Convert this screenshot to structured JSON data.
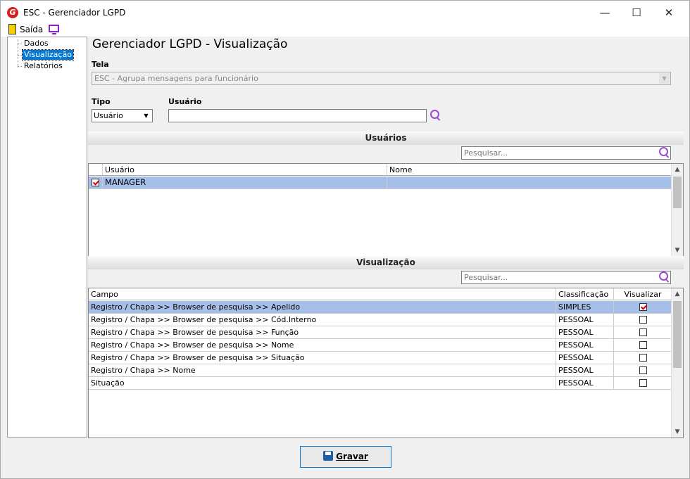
{
  "window": {
    "title": "ESC - Gerenciador LGPD",
    "logo_letter": "G"
  },
  "menubar": {
    "exit_label": "Saída"
  },
  "tree": {
    "items": [
      "Dados",
      "Visualização",
      "Relatórios"
    ],
    "selected": "Visualização"
  },
  "page_title": "Gerenciador LGPD - Visualização",
  "tela": {
    "label": "Tela",
    "value": "ESC - Agrupa mensagens para funcionário"
  },
  "tipo": {
    "label": "Tipo",
    "value": "Usuário"
  },
  "usuario": {
    "label": "Usuário",
    "value": ""
  },
  "usuarios_section": {
    "title": "Usuários",
    "filter_placeholder": "Pesquisar...",
    "columns": [
      "Usuário",
      "Nome"
    ],
    "rows": [
      {
        "checked": true,
        "usuario": "MANAGER",
        "nome": ""
      }
    ]
  },
  "visualizacao_section": {
    "title": "Visualização",
    "filter_placeholder": "Pesquisar...",
    "columns": [
      "Campo",
      "Classificação",
      "Visualizar"
    ],
    "rows": [
      {
        "campo": "Registro / Chapa >> Browser de pesquisa >> Apelido",
        "classificacao": "SIMPLES",
        "visualizar": true
      },
      {
        "campo": "Registro / Chapa >> Browser de pesquisa >> Cód.Interno",
        "classificacao": "PESSOAL",
        "visualizar": false
      },
      {
        "campo": "Registro / Chapa >> Browser de pesquisa >> Função",
        "classificacao": "PESSOAL",
        "visualizar": false
      },
      {
        "campo": "Registro / Chapa >> Browser de pesquisa >> Nome",
        "classificacao": "PESSOAL",
        "visualizar": false
      },
      {
        "campo": "Registro / Chapa >> Browser de pesquisa >> Situação",
        "classificacao": "PESSOAL",
        "visualizar": false
      },
      {
        "campo": "Registro / Chapa >> Nome",
        "classificacao": "PESSOAL",
        "visualizar": false
      },
      {
        "campo": "Situação",
        "classificacao": "PESSOAL",
        "visualizar": false
      }
    ]
  },
  "save_button": {
    "label": "Gravar"
  }
}
